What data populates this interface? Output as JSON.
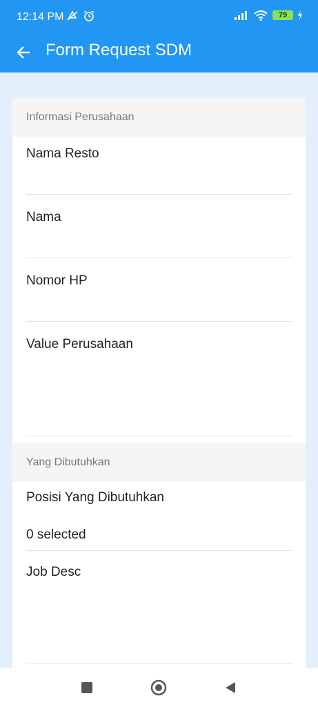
{
  "status": {
    "time": "12:14 PM",
    "battery": "79"
  },
  "appbar": {
    "title": "Form Request SDM"
  },
  "sections": {
    "company": {
      "header": "Informasi Perusahaan",
      "fields": {
        "nama_resto": "Nama Resto",
        "nama": "Nama",
        "nomor_hp": "Nomor HP",
        "value_perusahaan": "Value Perusahaan"
      }
    },
    "needs": {
      "header": "Yang Dibutuhkan",
      "posisi_label": "Posisi Yang Dibutuhkan",
      "posisi_value": "0 selected",
      "job_desc": "Job Desc"
    }
  },
  "colors": {
    "primary": "#2196f3",
    "background": "#e3f0fc",
    "section_header": "#f5f5f5",
    "battery": "#8be05a"
  },
  "icons": {
    "back": "arrow-left-icon",
    "nav_recent": "square-icon",
    "nav_home": "circle-icon",
    "nav_back": "triangle-left-icon"
  }
}
